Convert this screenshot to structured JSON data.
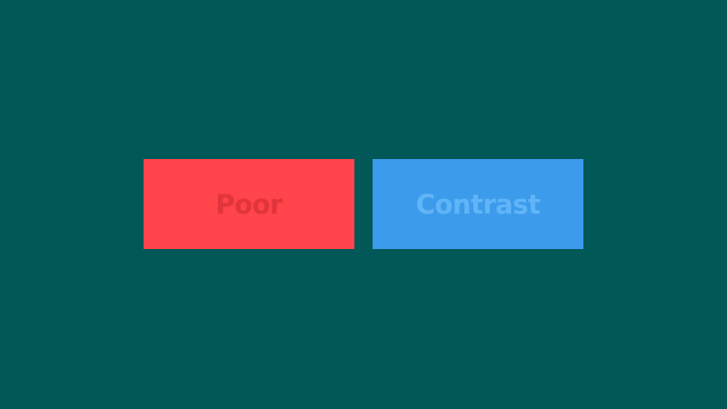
{
  "colors": {
    "background": "#025757",
    "left_tile_bg": "#FF444B",
    "left_tile_text": "#E2343B",
    "right_tile_bg": "#3D9BEB",
    "right_tile_text": "#60B5F8"
  },
  "tiles": {
    "left": {
      "label": "Poor"
    },
    "right": {
      "label": "Contrast"
    }
  }
}
